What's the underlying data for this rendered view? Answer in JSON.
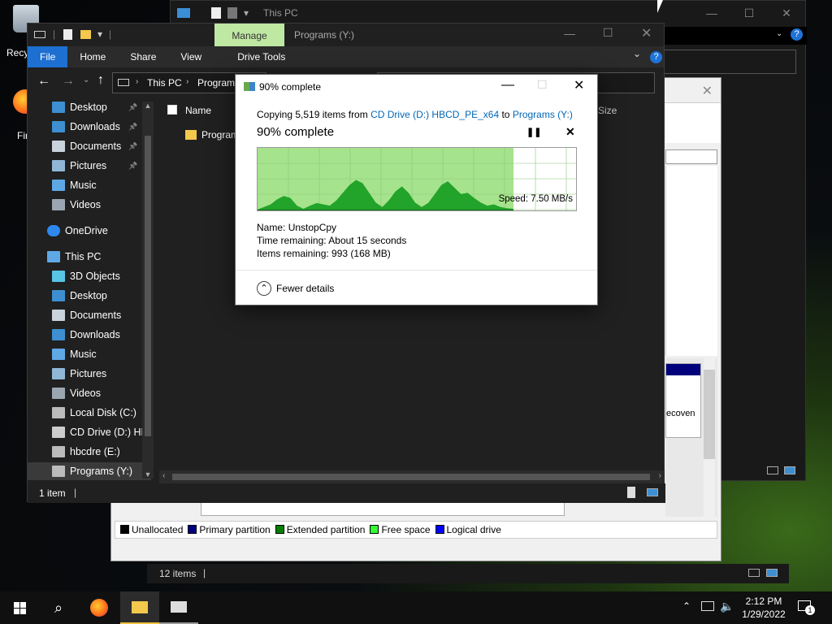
{
  "desktop": {
    "recycle_label": "Recy",
    "firefox_label": "Fir"
  },
  "back_window": {
    "title": "This PC"
  },
  "disk_window": {
    "legend": [
      {
        "label": "Unallocated",
        "color": "#000000"
      },
      {
        "label": "Primary partition",
        "color": "#000080"
      },
      {
        "label": "Extended partition",
        "color": "#008000"
      },
      {
        "label": "Free space",
        "color": "#33ff33"
      },
      {
        "label": "Logical drive",
        "color": "#0000ff"
      }
    ],
    "partition_fragment": "ecoven",
    "status_items": "12 items"
  },
  "explorer": {
    "manage_tab": "Manage",
    "title": "Programs (Y:)",
    "ribbon_tabs": [
      "File",
      "Home",
      "Share",
      "View",
      "Drive Tools"
    ],
    "address": [
      "This PC",
      "Program"
    ],
    "columns": {
      "name": "Name",
      "size": "Size"
    },
    "files": [
      {
        "name": "Program"
      }
    ],
    "status": "1 item",
    "nav": [
      {
        "label": "Desktop",
        "icon": "desktop-icon",
        "pinned": true
      },
      {
        "label": "Downloads",
        "icon": "downloads-icon",
        "pinned": true
      },
      {
        "label": "Documents",
        "icon": "documents-icon",
        "pinned": true
      },
      {
        "label": "Pictures",
        "icon": "pictures-icon",
        "pinned": true
      },
      {
        "label": "Music",
        "icon": "music-icon",
        "pinned": false
      },
      {
        "label": "Videos",
        "icon": "videos-icon",
        "pinned": false
      },
      {
        "label": "OneDrive",
        "icon": "onedrive-icon",
        "pinned": false
      },
      {
        "label": "This PC",
        "icon": "this-pc-icon",
        "pinned": false
      },
      {
        "label": "3D Objects",
        "icon": "3d-objects-icon",
        "pinned": false
      },
      {
        "label": "Desktop",
        "icon": "desktop-icon",
        "pinned": false
      },
      {
        "label": "Documents",
        "icon": "documents-icon",
        "pinned": false
      },
      {
        "label": "Downloads",
        "icon": "downloads-icon",
        "pinned": false
      },
      {
        "label": "Music",
        "icon": "music-icon",
        "pinned": false
      },
      {
        "label": "Pictures",
        "icon": "pictures-icon",
        "pinned": false
      },
      {
        "label": "Videos",
        "icon": "videos-icon",
        "pinned": false
      },
      {
        "label": "Local Disk (C:)",
        "icon": "drive-icon",
        "pinned": false
      },
      {
        "label": "CD Drive (D:) HB",
        "icon": "cd-drive-icon",
        "pinned": false
      },
      {
        "label": "hbcdre (E:)",
        "icon": "drive-icon",
        "pinned": false
      },
      {
        "label": "Programs (Y:)",
        "icon": "drive-icon",
        "pinned": false
      }
    ]
  },
  "copy_dialog": {
    "title": "90% complete",
    "copying_prefix": "Copying 5,519 items from",
    "source": "CD Drive (D:) HBCD_PE_x64",
    "to_word": "to",
    "destination": "Programs (Y:)",
    "headline": "90% complete",
    "progress_fraction": 0.9,
    "speed": "Speed: 7.50 MB/s",
    "name_label": "Name:",
    "name_value": "UnstopCpy",
    "time_label": "Time remaining:",
    "time_value": "About 15 seconds",
    "items_label": "Items remaining:",
    "items_value": "993 (168 MB)",
    "fewer_details": "Fewer details",
    "speed_profile": [
      0.04,
      0.08,
      0.12,
      0.2,
      0.25,
      0.22,
      0.1,
      0.05,
      0.1,
      0.14,
      0.12,
      0.1,
      0.18,
      0.3,
      0.42,
      0.5,
      0.45,
      0.3,
      0.15,
      0.08,
      0.18,
      0.32,
      0.4,
      0.3,
      0.15,
      0.08,
      0.14,
      0.28,
      0.42,
      0.48,
      0.38,
      0.28,
      0.3,
      0.22,
      0.15,
      0.1,
      0.12,
      0.08,
      0.06,
      0.05
    ]
  },
  "taskbar": {
    "time": "2:12 PM",
    "date": "1/29/2022",
    "notification_count": "1",
    "accent": "#f0c040"
  }
}
